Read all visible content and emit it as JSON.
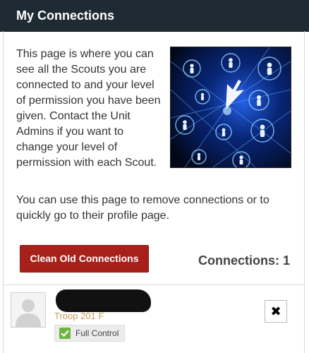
{
  "header": {
    "title": "My Connections"
  },
  "intro": {
    "text": "This page is where you can see all the Scouts you are connected to and your level of permission you have been given. Contact the Unit Admins if you want to change your level of permission with each Scout."
  },
  "note": {
    "text": "You can use this page to remove connections or to quickly go to their profile page."
  },
  "actions": {
    "clean_label": "Clean Old Connections"
  },
  "summary": {
    "connections_label": "Connections:",
    "connections_count": "1"
  },
  "connections": [
    {
      "troop": "Troop 201 F",
      "permission": "Full Control",
      "remove_symbol": "✖"
    }
  ],
  "icons": {
    "avatar": "person-silhouette-icon",
    "permission": "checkmark-icon",
    "remove": "close-icon"
  },
  "colors": {
    "header_bg": "#1f2b33",
    "button_bg": "#a8201a",
    "troop_text": "#c79a5b",
    "check_green": "#6cb33f"
  }
}
